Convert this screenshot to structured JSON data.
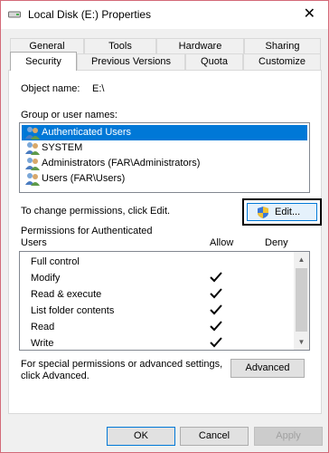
{
  "window": {
    "title": "Local Disk (E:) Properties",
    "close_label": "✕"
  },
  "tabs": {
    "row1": [
      "General",
      "Tools",
      "Hardware",
      "Sharing"
    ],
    "row2": [
      "Security",
      "Previous Versions",
      "Quota",
      "Customize"
    ],
    "active": "Security"
  },
  "security": {
    "object_name_label": "Object name:",
    "object_name_value": "E:\\",
    "group_label": "Group or user names:",
    "users": [
      "Authenticated Users",
      "SYSTEM",
      "Administrators (FAR\\Administrators)",
      "Users (FAR\\Users)"
    ],
    "selected_user_index": 0,
    "change_text": "To change permissions, click Edit.",
    "edit_label": "Edit...",
    "perm_header_line1": "Permissions for Authenticated",
    "perm_header_line2": "Users",
    "allow_label": "Allow",
    "deny_label": "Deny",
    "permissions": [
      {
        "name": "Full control",
        "allow": false
      },
      {
        "name": "Modify",
        "allow": true
      },
      {
        "name": "Read & execute",
        "allow": true
      },
      {
        "name": "List folder contents",
        "allow": true
      },
      {
        "name": "Read",
        "allow": true
      },
      {
        "name": "Write",
        "allow": true
      }
    ],
    "special_line1": "For special permissions or advanced settings,",
    "special_line2": "click Advanced.",
    "advanced_label": "Advanced"
  },
  "footer": {
    "ok_label": "OK",
    "cancel_label": "Cancel",
    "apply_label": "Apply"
  },
  "colors": {
    "selection": "#0078d7",
    "title_border": "#d36a78"
  },
  "icons": {
    "title": "drive-icon",
    "user": "user-group-icon",
    "shield": "uac-shield-icon",
    "check": "checkmark-icon"
  }
}
